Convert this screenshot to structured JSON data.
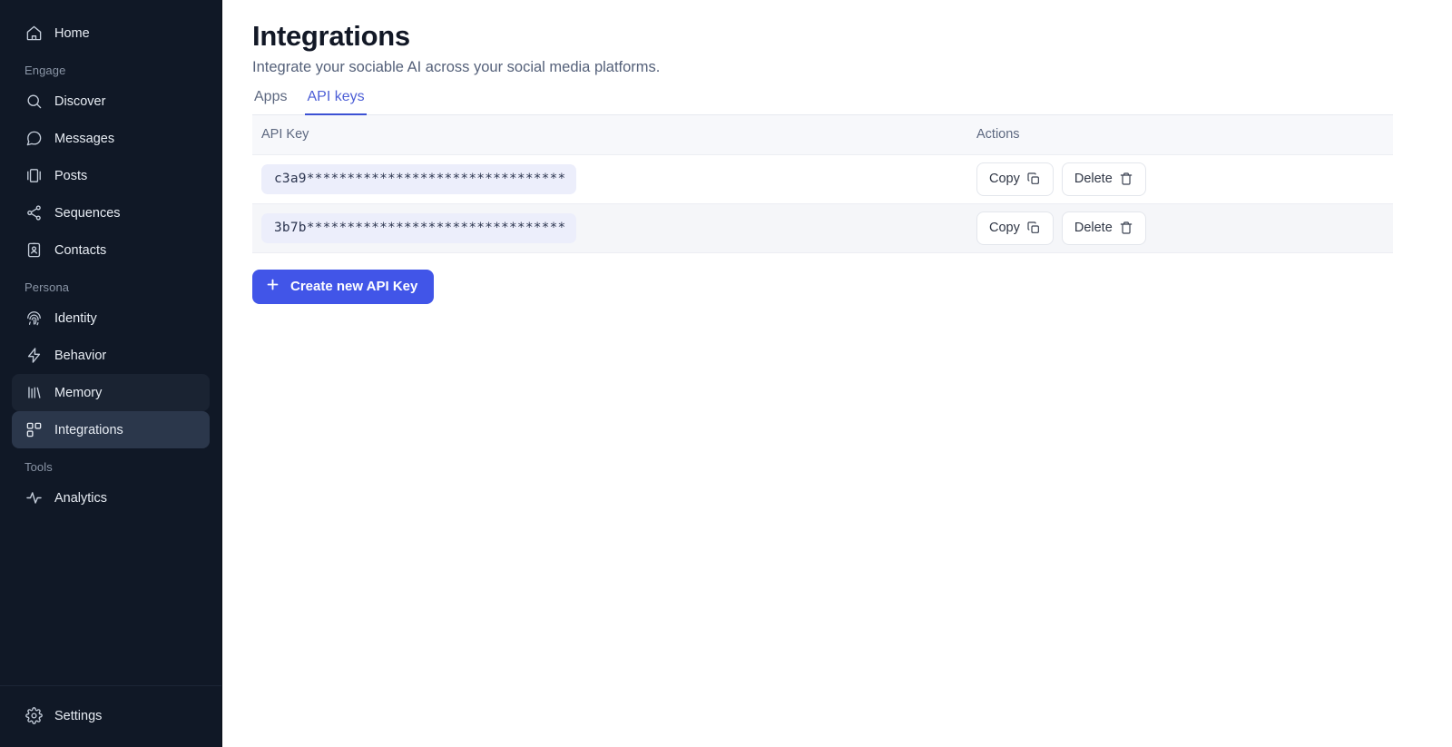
{
  "sidebar": {
    "groups": [
      {
        "label": null,
        "items": [
          {
            "label": "Home",
            "icon": "home-icon",
            "state": "normal"
          }
        ]
      },
      {
        "label": "Engage",
        "items": [
          {
            "label": "Discover",
            "icon": "search-icon",
            "state": "normal"
          },
          {
            "label": "Messages",
            "icon": "message-icon",
            "state": "normal"
          },
          {
            "label": "Posts",
            "icon": "posts-icon",
            "state": "normal"
          },
          {
            "label": "Sequences",
            "icon": "sequences-icon",
            "state": "normal"
          },
          {
            "label": "Contacts",
            "icon": "contacts-icon",
            "state": "normal"
          }
        ]
      },
      {
        "label": "Persona",
        "items": [
          {
            "label": "Identity",
            "icon": "fingerprint-icon",
            "state": "normal"
          },
          {
            "label": "Behavior",
            "icon": "bolt-icon",
            "state": "normal"
          },
          {
            "label": "Memory",
            "icon": "memory-icon",
            "state": "hovered"
          },
          {
            "label": "Integrations",
            "icon": "blocks-icon",
            "state": "active"
          }
        ]
      },
      {
        "label": "Tools",
        "items": [
          {
            "label": "Analytics",
            "icon": "activity-icon",
            "state": "normal"
          }
        ]
      }
    ],
    "footer": {
      "label": "Settings",
      "icon": "gear-icon"
    }
  },
  "header": {
    "title": "Integrations",
    "subtitle": "Integrate your sociable AI across your social media platforms."
  },
  "tabs": [
    {
      "label": "Apps",
      "active": false
    },
    {
      "label": "API keys",
      "active": true
    }
  ],
  "table": {
    "columns": [
      {
        "label": "API Key"
      },
      {
        "label": "Actions"
      }
    ],
    "rows": [
      {
        "key": "c3a9********************************",
        "copy_label": "Copy",
        "delete_label": "Delete"
      },
      {
        "key": "3b7b********************************",
        "copy_label": "Copy",
        "delete_label": "Delete"
      }
    ]
  },
  "create_button": {
    "label": "Create new API Key",
    "icon": "plus-icon"
  },
  "colors": {
    "sidebar_bg": "#101826",
    "sidebar_active": "#2b374b",
    "sidebar_hover": "#1a2332",
    "accent": "#4155e8",
    "tab_active": "#4d5fd6",
    "key_pill_bg": "#eceefb",
    "row_stripe": "#f5f6f9",
    "table_head_bg": "#f7f8fb"
  }
}
